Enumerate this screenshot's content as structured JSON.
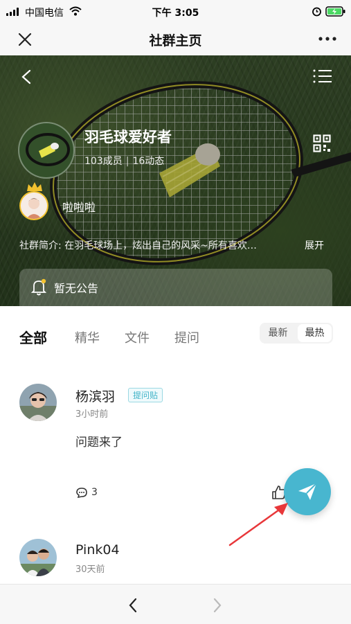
{
  "status_bar": {
    "carrier": "中国电信",
    "time": "下午 3:05"
  },
  "nav": {
    "title": "社群主页",
    "close_icon": "close-icon",
    "more_icon": "more-icon"
  },
  "group": {
    "name": "羽毛球爱好者",
    "members": "103成员",
    "posts": "16动态",
    "separator": "|",
    "owner_name": "啦啦啦",
    "intro": "社群简介: 在羽毛球场上，炫出自己的风采~所有喜欢…",
    "intro_more": "展开",
    "notice": "暂无公告"
  },
  "tabs": {
    "items": [
      "全部",
      "精华",
      "文件",
      "提问"
    ],
    "active_index": 0,
    "sort_options": [
      "最新",
      "最热"
    ],
    "sort_selected": "最热"
  },
  "posts": [
    {
      "author": "杨滨羽",
      "badge": "提问贴",
      "time": "3小时前",
      "body": "问题来了",
      "comments": "3"
    },
    {
      "author": "Pink04",
      "time": "30天前"
    }
  ],
  "colors": {
    "accent": "#48b6cf",
    "badge_text": "#3fb3c7",
    "arrow": "#e8373a",
    "crown": "#f2c230"
  },
  "icons": {
    "back": "back-icon",
    "list": "list-icon",
    "qrcode": "qrcode-icon",
    "bell": "bell-icon",
    "comment": "comment-icon",
    "like": "thumbs-up-icon",
    "send": "send-icon",
    "prev": "chevron-left-icon",
    "next": "chevron-right-icon"
  }
}
